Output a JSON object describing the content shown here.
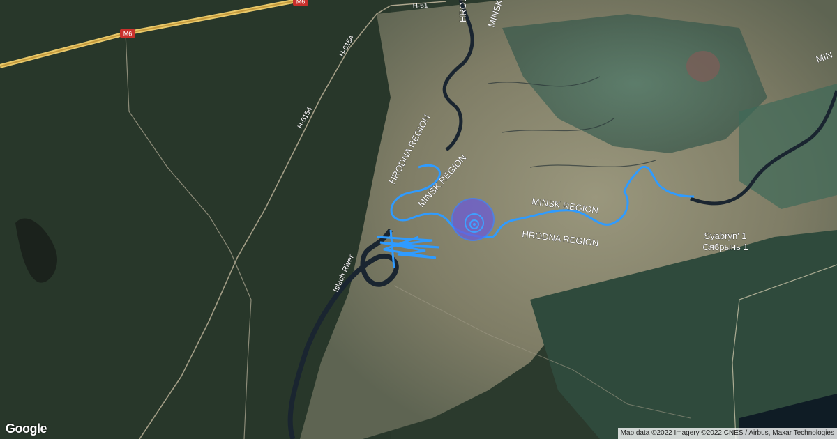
{
  "map": {
    "roads": {
      "m6": "M6",
      "h6154_north": "H-6154",
      "h6154_south": "H-6154",
      "h61_top": "H-61"
    },
    "regions": {
      "hrodna_upper": "HRODNA REGION",
      "minsk_upper": "MINSK REGION",
      "minsk_lower": "MINSK REGION",
      "hrodna_lower": "HRODNA REGION",
      "hrodna_top": "HRODNA",
      "minsk_top": "MINSK",
      "minsk_right_edge": "MIN"
    },
    "river": "Islach River",
    "place": {
      "latin": "Syabryn' 1",
      "cyrillic": "Сябрынь 1"
    },
    "colors": {
      "track": "#2f9bff",
      "marker_fill": "#6b5bd6",
      "marker_ring": "#3f7fff",
      "river": "#1a2530",
      "forest": "#2c3b2c",
      "marsh": "#8c8a73"
    }
  },
  "branding": {
    "logo_text": "Google"
  },
  "attribution": {
    "text": "Map data ©2022 Imagery ©2022 CNES / Airbus, Maxar Technologies"
  }
}
